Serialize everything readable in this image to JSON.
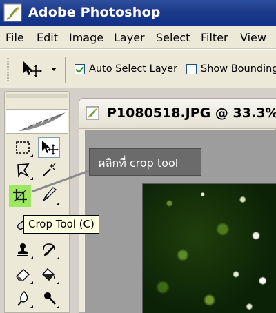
{
  "app": {
    "title": "Adobe Photoshop",
    "icon": "photoshop-feather-icon"
  },
  "menu": {
    "items": [
      "File",
      "Edit",
      "Image",
      "Layer",
      "Select",
      "Filter",
      "View"
    ]
  },
  "options": {
    "move_tool_icon": "move-tool-icon",
    "auto_select_layer": {
      "label": "Auto Select Layer",
      "checked": true
    },
    "show_bounding": {
      "label": "Show Bounding",
      "checked": false
    }
  },
  "toolbox": {
    "logo": "feather-logo-icon",
    "tools": [
      {
        "name": "rectangular-marquee-tool"
      },
      {
        "name": "move-tool",
        "state": "selected"
      },
      {
        "name": "lasso-tool"
      },
      {
        "name": "magic-wand-tool"
      },
      {
        "name": "crop-tool",
        "state": "highlighted",
        "highlight_color": "#9be75f"
      },
      {
        "name": "slice-tool"
      },
      {
        "name": "healing-brush-tool"
      },
      {
        "name": "brush-tool"
      },
      {
        "name": "clone-stamp-tool"
      },
      {
        "name": "history-brush-tool"
      },
      {
        "name": "eraser-tool"
      },
      {
        "name": "paint-bucket-tool"
      },
      {
        "name": "blur-tool"
      },
      {
        "name": "dodge-tool"
      }
    ],
    "tooltip": "Crop Tool (C)"
  },
  "document": {
    "title": "P1080518.JPG @ 33.3%"
  },
  "callout": {
    "text": "คลิกที่ crop tool",
    "background": "#6b6b6b"
  },
  "colors": {
    "titlebar": "#1c3a8a",
    "crop_highlight": "#9be75f"
  }
}
